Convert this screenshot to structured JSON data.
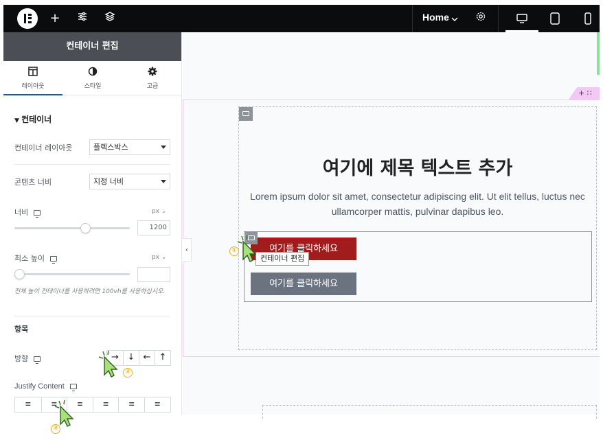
{
  "topbar": {
    "page_label": "Home",
    "icons": [
      "elementor-logo",
      "plus-icon",
      "sliders-icon",
      "layers-icon",
      "chevron-down-icon",
      "gear-icon",
      "desktop-icon",
      "tablet-icon",
      "mobile-icon"
    ]
  },
  "panel": {
    "title": "컨테이너 편집",
    "tabs": [
      {
        "label": "레이아웃",
        "icon": "layout-icon",
        "active": true
      },
      {
        "label": "스타일",
        "icon": "style-icon",
        "active": false
      },
      {
        "label": "고급",
        "icon": "gear-icon",
        "active": false
      }
    ],
    "section": "컨테이너",
    "container_layout": {
      "label": "컨테이너 레이아웃",
      "value": "플렉스박스"
    },
    "content_width": {
      "label": "콘텐츠 너비",
      "value": "지정 너비"
    },
    "width": {
      "label": "너비",
      "unit": "px",
      "value": "1200",
      "slider_fraction": 0.63
    },
    "min_height": {
      "label": "최소 높이",
      "unit": "px",
      "value": "",
      "slider_fraction": 0.0
    },
    "min_height_hint": "전체 높이 컨테이너를 사용하려면 100vh를 사용하십시오.",
    "items_heading": "항목",
    "direction": {
      "label": "방향",
      "options": [
        "→",
        "↓",
        "←",
        "↑"
      ]
    },
    "justify": {
      "label": "Justify Content",
      "options": [
        "≡",
        "≡",
        "≡",
        "≡",
        "≡",
        "≡"
      ]
    }
  },
  "canvas": {
    "heading": "여기에 제목 텍스트 추가",
    "paragraph": "Lorem ipsum dolor sit amet, consectetur adipiscing elit. Ut elit tellus, luctus nec ullamcorper mattis, pulvinar dapibus leo.",
    "button1": "여기를 클릭하세요",
    "button2": "여기를 클릭하세요",
    "tooltip": "컨테이너 편집",
    "add_tab": "+ ∷",
    "collapse": "‹"
  },
  "annotations": [
    "①",
    "②",
    "③"
  ],
  "colors": {
    "accent": "#0c5ab7",
    "button_primary": "#a11d1d",
    "button_secondary": "#6b7280",
    "marker": "#e8b21c",
    "cursor_fill": "#a8e07a"
  }
}
